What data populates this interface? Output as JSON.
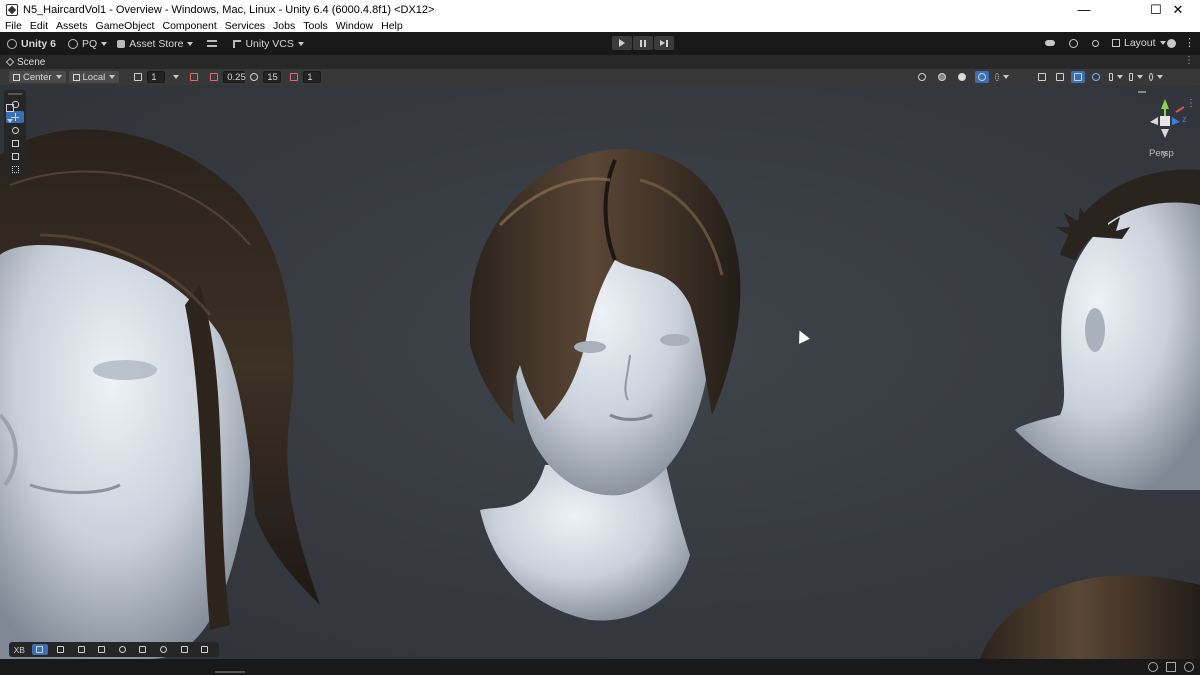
{
  "window": {
    "title": "N5_HaircardVol1 - Overview - Windows, Mac, Linux - Unity 6.4 (6000.4.8f1) <DX12>",
    "minimize": "—",
    "maximize": "☐",
    "close": "✕"
  },
  "menu": [
    "File",
    "Edit",
    "Assets",
    "GameObject",
    "Component",
    "Services",
    "Jobs",
    "Tools",
    "Window",
    "Help"
  ],
  "toolbar": {
    "unity_label": "Unity 6",
    "account_label": "PQ",
    "asset_store_label": "Asset Store",
    "vcs_label": "Unity VCS",
    "layout_label": "Layout"
  },
  "scene_tab": {
    "label": "Scene"
  },
  "scene_toolbar": {
    "pivot_label": "Center",
    "space_label": "Local",
    "grid_value": "1",
    "snap_value": "0.25",
    "angle_value": "15",
    "scale_value": "1"
  },
  "gizmo": {
    "y_label": "y",
    "z_label": "z",
    "projection_label": "Persp"
  },
  "bottom_overlay": {
    "xr_label": "XB"
  },
  "colors": {
    "accent_blue": "#3a6fb6",
    "viewport_bg": "#373b41",
    "gizmo_y": "#8fd14f",
    "gizmo_z": "#3b7de0",
    "gizmo_x": "#d9534f"
  }
}
